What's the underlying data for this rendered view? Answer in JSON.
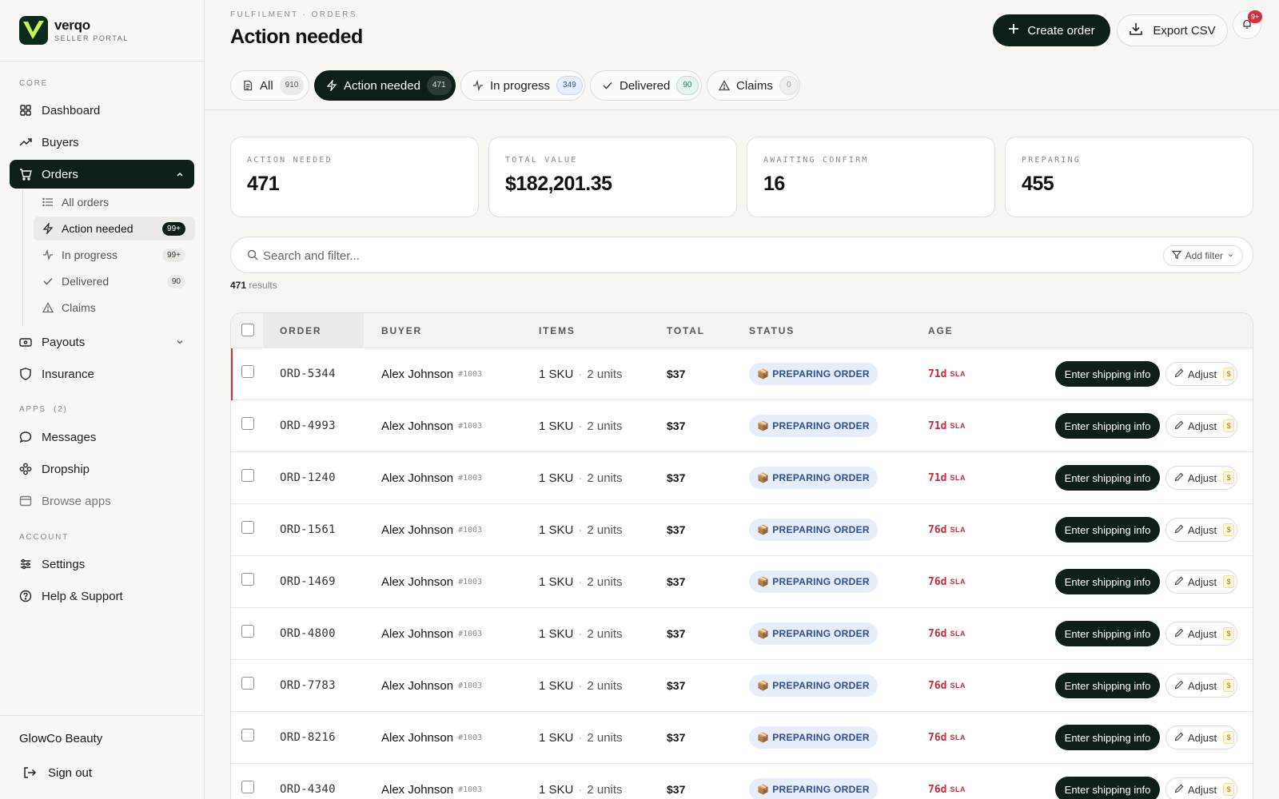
{
  "brand": {
    "name": "verqo",
    "subtitle": "SELLER PORTAL"
  },
  "sidebar": {
    "sections": {
      "core": "CORE",
      "apps": "APPS",
      "apps_count": "(2)",
      "account": "ACCOUNT"
    },
    "items": [
      {
        "label": "Dashboard",
        "icon": "grid-icon"
      },
      {
        "label": "Buyers",
        "icon": "trend-icon"
      },
      {
        "label": "Orders",
        "icon": "cart-icon",
        "active": true
      },
      {
        "label": "Payouts",
        "icon": "wallet-icon"
      },
      {
        "label": "Insurance",
        "icon": "shield-icon"
      },
      {
        "label": "Messages",
        "icon": "chat-icon"
      },
      {
        "label": "Dropship",
        "icon": "network-icon"
      },
      {
        "label": "Browse apps",
        "icon": "window-icon"
      },
      {
        "label": "Settings",
        "icon": "sliders-icon"
      },
      {
        "label": "Help & Support",
        "icon": "help-icon"
      }
    ],
    "orders_sub": [
      {
        "label": "All orders",
        "badge": ""
      },
      {
        "label": "Action needed",
        "badge": "99+"
      },
      {
        "label": "In progress",
        "badge": "99+"
      },
      {
        "label": "Delivered",
        "badge": "90"
      },
      {
        "label": "Claims",
        "badge": ""
      }
    ],
    "store_name": "GlowCo Beauty",
    "sign_out": "Sign out"
  },
  "header": {
    "breadcrumb": "FULFILMENT · ORDERS",
    "title": "Action needed",
    "create_label": "Create order",
    "export_label": "Export CSV",
    "notifications_badge": "9+"
  },
  "tabs": [
    {
      "label": "All",
      "count": "910"
    },
    {
      "label": "Action needed",
      "count": "471",
      "active": true
    },
    {
      "label": "In progress",
      "count": "349"
    },
    {
      "label": "Delivered",
      "count": "90"
    },
    {
      "label": "Claims",
      "count": "0"
    }
  ],
  "stats": [
    {
      "label": "ACTION NEEDED",
      "value": "471"
    },
    {
      "label": "TOTAL VALUE",
      "value": "$182,201.35"
    },
    {
      "label": "AWAITING CONFIRM",
      "value": "16"
    },
    {
      "label": "PREPARING",
      "value": "455"
    }
  ],
  "search": {
    "placeholder": "Search and filter...",
    "add_filter": "Add filter"
  },
  "results": {
    "count": "471",
    "label": "results"
  },
  "table": {
    "columns": [
      "ORDER",
      "BUYER",
      "ITEMS",
      "TOTAL",
      "STATUS",
      "AGE"
    ],
    "ship_label": "Enter shipping info",
    "adjust_label": "Adjust",
    "adjust_badge": "$",
    "rows": [
      {
        "order": "ORD-5344",
        "buyer": "Alex Johnson",
        "buyer_id": "#1003",
        "sku": "1 SKU",
        "sep": "·",
        "units": "2 units",
        "total": "$37",
        "status": "PREPARING ORDER",
        "age": "71d",
        "sla": "SLA"
      },
      {
        "order": "ORD-4993",
        "buyer": "Alex Johnson",
        "buyer_id": "#1003",
        "sku": "1 SKU",
        "sep": "·",
        "units": "2 units",
        "total": "$37",
        "status": "PREPARING ORDER",
        "age": "71d",
        "sla": "SLA"
      },
      {
        "order": "ORD-1240",
        "buyer": "Alex Johnson",
        "buyer_id": "#1003",
        "sku": "1 SKU",
        "sep": "·",
        "units": "2 units",
        "total": "$37",
        "status": "PREPARING ORDER",
        "age": "71d",
        "sla": "SLA"
      },
      {
        "order": "ORD-1561",
        "buyer": "Alex Johnson",
        "buyer_id": "#1003",
        "sku": "1 SKU",
        "sep": "·",
        "units": "2 units",
        "total": "$37",
        "status": "PREPARING ORDER",
        "age": "76d",
        "sla": "SLA"
      },
      {
        "order": "ORD-1469",
        "buyer": "Alex Johnson",
        "buyer_id": "#1003",
        "sku": "1 SKU",
        "sep": "·",
        "units": "2 units",
        "total": "$37",
        "status": "PREPARING ORDER",
        "age": "76d",
        "sla": "SLA"
      },
      {
        "order": "ORD-4800",
        "buyer": "Alex Johnson",
        "buyer_id": "#1003",
        "sku": "1 SKU",
        "sep": "·",
        "units": "2 units",
        "total": "$37",
        "status": "PREPARING ORDER",
        "age": "76d",
        "sla": "SLA"
      },
      {
        "order": "ORD-7783",
        "buyer": "Alex Johnson",
        "buyer_id": "#1003",
        "sku": "1 SKU",
        "sep": "·",
        "units": "2 units",
        "total": "$37",
        "status": "PREPARING ORDER",
        "age": "76d",
        "sla": "SLA"
      },
      {
        "order": "ORD-8216",
        "buyer": "Alex Johnson",
        "buyer_id": "#1003",
        "sku": "1 SKU",
        "sep": "·",
        "units": "2 units",
        "total": "$37",
        "status": "PREPARING ORDER",
        "age": "76d",
        "sla": "SLA"
      },
      {
        "order": "ORD-4340",
        "buyer": "Alex Johnson",
        "buyer_id": "#1003",
        "sku": "1 SKU",
        "sep": "·",
        "units": "2 units",
        "total": "$37",
        "status": "PREPARING ORDER",
        "age": "76d",
        "sla": "SLA"
      }
    ]
  },
  "colors": {
    "primary_dark": "#0d1f18",
    "alert_red": "#d92d3e",
    "status_blue": "#2f4d97"
  }
}
